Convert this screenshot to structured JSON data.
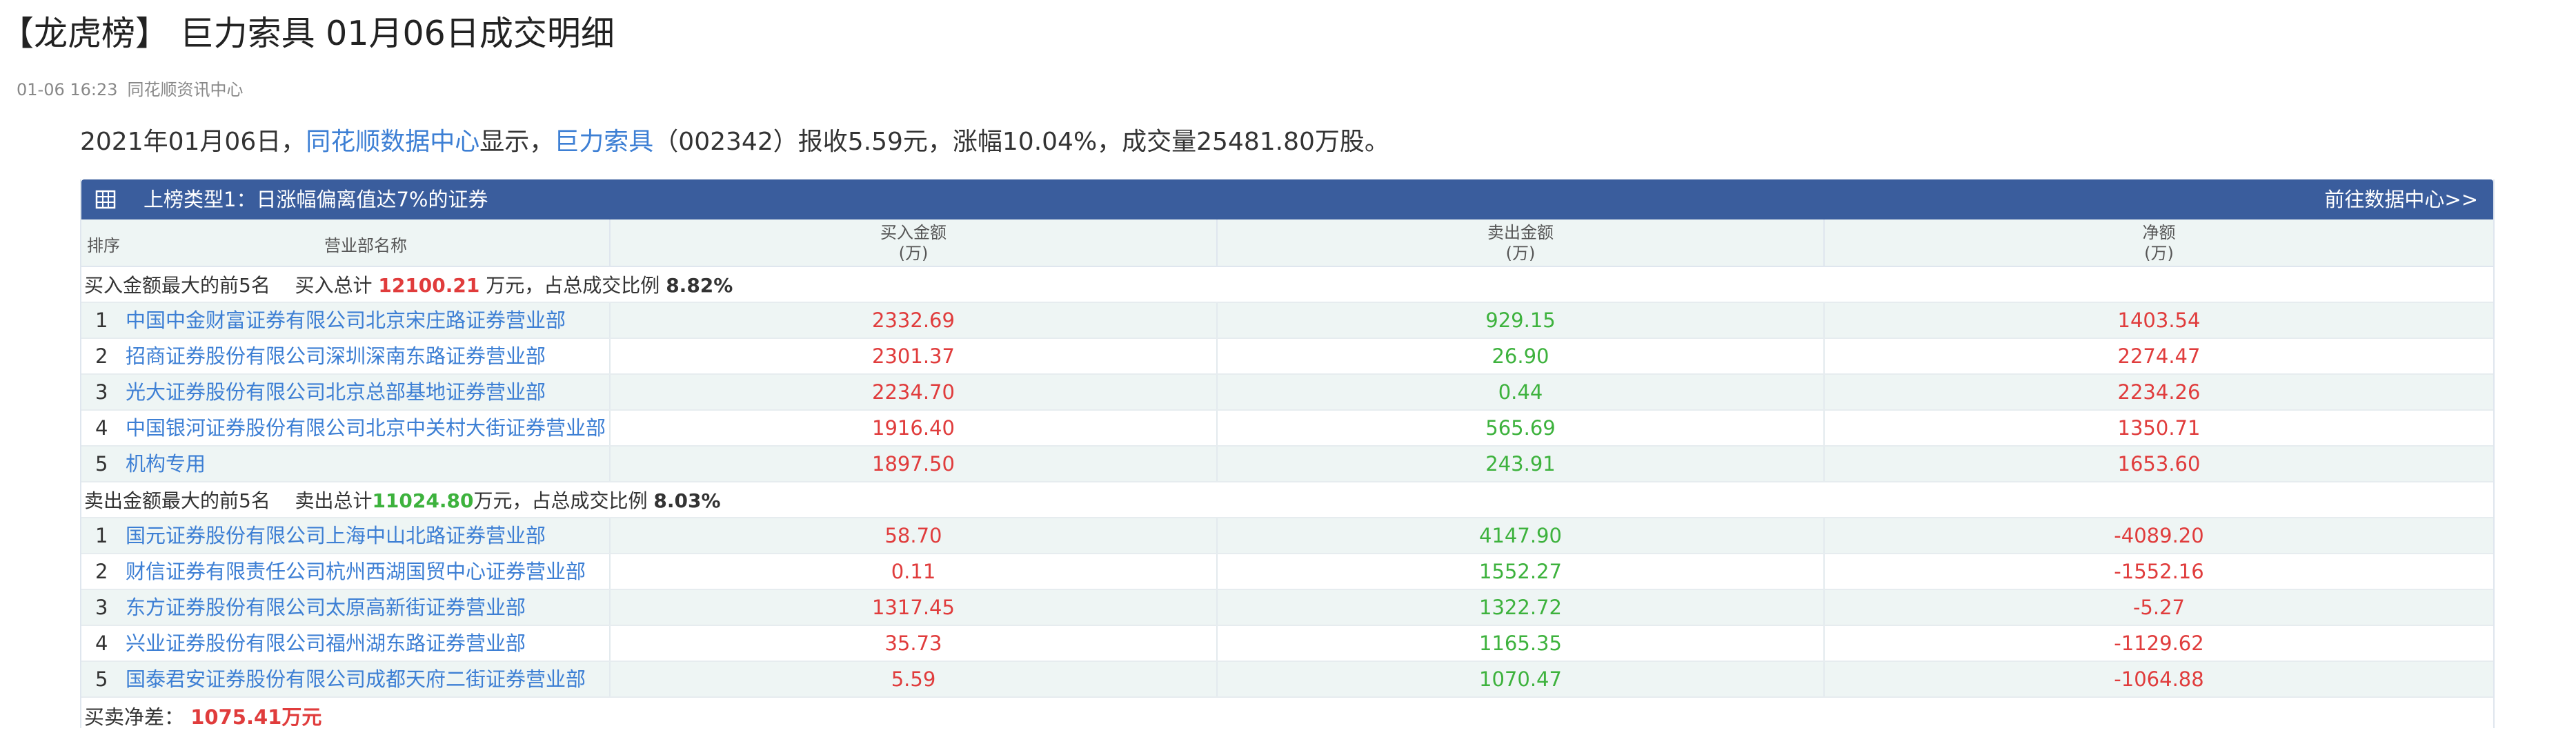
{
  "article": {
    "title": "【龙虎榜】 巨力索具 01月06日成交明细",
    "time": "01-06 16:23",
    "source": "同花顺资讯中心"
  },
  "intro": {
    "prefix": "2021年01月06日，",
    "link1": "同花顺数据中心",
    "mid1": "显示，",
    "link2": "巨力索具",
    "suffix": "（002342）报收5.59元，涨幅10.04%，成交量25481.80万股。"
  },
  "board": {
    "title": "上榜类型1：日涨幅偏离值达7%的证券",
    "goto_link": "前往数据中心>>",
    "icon": "table-grid-icon",
    "header_color": "#3a5d9d"
  },
  "columns": {
    "rank": "排序",
    "dept": "营业部名称",
    "buy_line1": "买入金额",
    "buy_line2": "(万)",
    "sell_line1": "卖出金额",
    "sell_line2": "(万)",
    "net_line1": "净额",
    "net_line2": "(万)"
  },
  "buy_group": {
    "label": "买入金额最大的前5名",
    "total_label": "买入总计",
    "total_value": "12100.21",
    "unit_text": "万元，占总成交比例",
    "ratio": "8.82%"
  },
  "buy_rows": [
    {
      "rank": "1",
      "dept": "中国中金财富证券有限公司北京宋庄路证券营业部",
      "buy": "2332.69",
      "sell": "929.15",
      "net": "1403.54"
    },
    {
      "rank": "2",
      "dept": "招商证券股份有限公司深圳深南东路证券营业部",
      "buy": "2301.37",
      "sell": "26.90",
      "net": "2274.47"
    },
    {
      "rank": "3",
      "dept": "光大证券股份有限公司北京总部基地证券营业部",
      "buy": "2234.70",
      "sell": "0.44",
      "net": "2234.26"
    },
    {
      "rank": "4",
      "dept": "中国银河证券股份有限公司北京中关村大街证券营业部",
      "buy": "1916.40",
      "sell": "565.69",
      "net": "1350.71"
    },
    {
      "rank": "5",
      "dept": "机构专用",
      "buy": "1897.50",
      "sell": "243.91",
      "net": "1653.60"
    }
  ],
  "sell_group": {
    "label": "卖出金额最大的前5名",
    "total_label": "卖出总计",
    "total_value": "11024.80",
    "unit_text": "万元，占总成交比例",
    "ratio": "8.03%"
  },
  "sell_rows": [
    {
      "rank": "1",
      "dept": "国元证券股份有限公司上海中山北路证券营业部",
      "buy": "58.70",
      "sell": "4147.90",
      "net": "-4089.20"
    },
    {
      "rank": "2",
      "dept": "财信证券有限责任公司杭州西湖国贸中心证券营业部",
      "buy": "0.11",
      "sell": "1552.27",
      "net": "-1552.16"
    },
    {
      "rank": "3",
      "dept": "东方证券股份有限公司太原高新街证券营业部",
      "buy": "1317.45",
      "sell": "1322.72",
      "net": "-5.27"
    },
    {
      "rank": "4",
      "dept": "兴业证券股份有限公司福州湖东路证券营业部",
      "buy": "35.73",
      "sell": "1165.35",
      "net": "-1129.62"
    },
    {
      "rank": "5",
      "dept": "国泰君安证券股份有限公司成都天府二街证券营业部",
      "buy": "5.59",
      "sell": "1070.47",
      "net": "-1064.88"
    }
  ],
  "net": {
    "label": "买卖净差：",
    "value": "1075.41万元"
  },
  "colors": {
    "buy_red": "#e03c3c",
    "sell_green": "#3db23d",
    "link_blue": "#3d7fd4"
  }
}
